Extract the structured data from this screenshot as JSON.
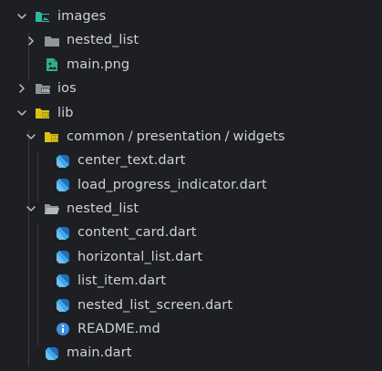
{
  "explorer": {
    "items": [
      {
        "id": "images",
        "label": "images",
        "depth": 0,
        "kind": "folder",
        "expanded": true,
        "icon": "folder-images-open-icon",
        "children_count": 2
      },
      {
        "id": "nested_list_img",
        "label": "nested_list",
        "depth": 1,
        "kind": "folder",
        "expanded": false,
        "icon": "folder-closed-icon"
      },
      {
        "id": "main_png",
        "label": "main.png",
        "depth": 1,
        "kind": "file",
        "icon": "image-file-icon"
      },
      {
        "id": "ios",
        "label": "ios",
        "depth": 0,
        "kind": "folder",
        "expanded": false,
        "icon": "folder-ios-icon"
      },
      {
        "id": "lib",
        "label": "lib",
        "depth": 0,
        "kind": "folder",
        "expanded": true,
        "icon": "folder-lib-open-icon"
      },
      {
        "id": "common",
        "label_parts": [
          "common",
          "presentation",
          "widgets"
        ],
        "label_separator": "/",
        "depth": 1,
        "kind": "folder",
        "expanded": true,
        "icon": "folder-common-open-icon"
      },
      {
        "id": "center_text",
        "label": "center_text.dart",
        "depth": 2,
        "kind": "file",
        "icon": "dart-file-icon"
      },
      {
        "id": "load_progress",
        "label": "load_progress_indicator.dart",
        "depth": 2,
        "kind": "file",
        "icon": "dart-file-icon"
      },
      {
        "id": "nested_list_lib",
        "label": "nested_list",
        "depth": 1,
        "kind": "folder",
        "expanded": true,
        "icon": "folder-open-icon"
      },
      {
        "id": "content_card",
        "label": "content_card.dart",
        "depth": 2,
        "kind": "file",
        "icon": "dart-file-icon"
      },
      {
        "id": "horizontal_list",
        "label": "horizontal_list.dart",
        "depth": 2,
        "kind": "file",
        "icon": "dart-file-icon"
      },
      {
        "id": "list_item",
        "label": "list_item.dart",
        "depth": 2,
        "kind": "file",
        "icon": "dart-file-icon"
      },
      {
        "id": "nested_list_screen",
        "label": "nested_list_screen.dart",
        "depth": 2,
        "kind": "file",
        "icon": "dart-file-icon"
      },
      {
        "id": "readme",
        "label": "README.md",
        "depth": 2,
        "kind": "file",
        "icon": "info-file-icon"
      },
      {
        "id": "main_dart",
        "label": "main.dart",
        "depth": 1,
        "kind": "file",
        "icon": "dart-file-icon"
      }
    ]
  },
  "colors": {
    "background": "#1e1f22",
    "text": "#cfd2d6",
    "chevron": "#c5c8cc",
    "guide": "#3a3c41",
    "folder_gray": "#8f9499",
    "folder_teal": "#2fb7a5",
    "folder_yellow": "#d8c21a",
    "dart_blue": "#41a6e8",
    "dart_dark": "#1f6fb6",
    "info_blue": "#3d8fe0",
    "image_green": "#2db08a"
  }
}
